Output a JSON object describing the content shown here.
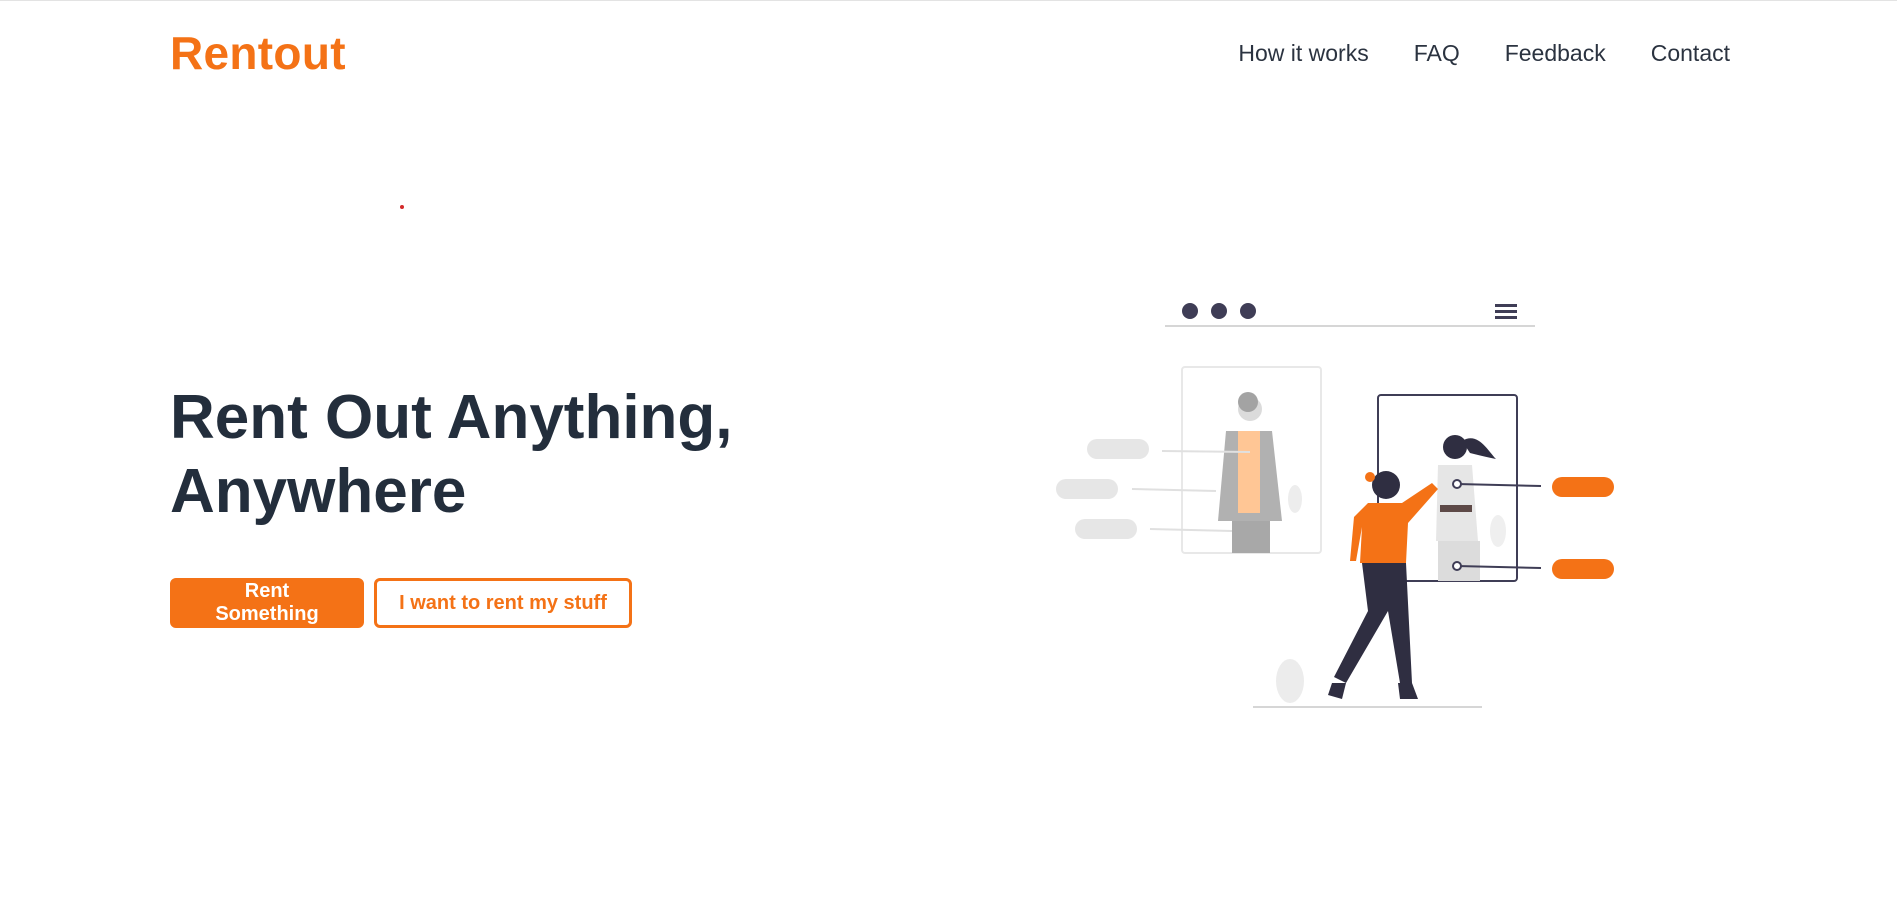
{
  "brand": {
    "name": "Rentout",
    "accent_color": "#f47216"
  },
  "nav": {
    "items": [
      {
        "label": "How it works"
      },
      {
        "label": "FAQ"
      },
      {
        "label": "Feedback"
      },
      {
        "label": "Contact"
      }
    ]
  },
  "hero": {
    "title_line1": "Rent Out Anything,",
    "title_line2": "Anywhere",
    "primary_button": "Rent Something",
    "secondary_button": "I want to rent my stuff"
  },
  "illustration": {
    "icon": "browser-window-people-illustration"
  }
}
